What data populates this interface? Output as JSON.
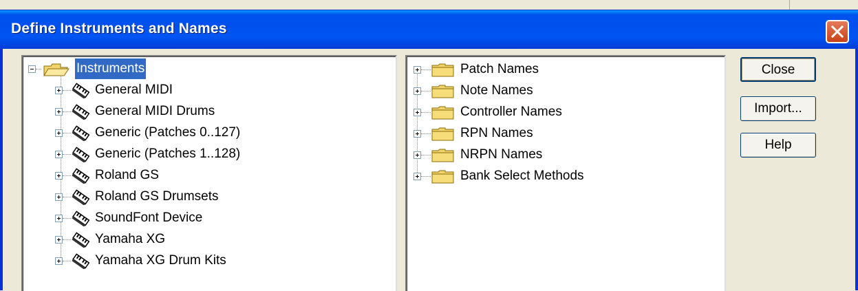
{
  "dialog": {
    "title": "Define Instruments and Names",
    "close_icon": "close-x-icon"
  },
  "left_tree": {
    "root": {
      "label": "Instruments",
      "expanded": true,
      "selected": true
    },
    "items": [
      "General MIDI",
      "General MIDI Drums",
      "Generic (Patches 0..127)",
      "Generic (Patches 1..128)",
      "Roland GS",
      "Roland GS Drumsets",
      "SoundFont Device",
      "Yamaha XG",
      "Yamaha XG Drum Kits"
    ]
  },
  "right_tree": {
    "items": [
      "Patch Names",
      "Note Names",
      "Controller Names",
      "RPN Names",
      "NRPN Names",
      "Bank Select Methods"
    ]
  },
  "buttons": {
    "close": "Close",
    "import": "Import...",
    "help": "Help"
  },
  "colors": {
    "titlebar": "#0055ea",
    "selection": "#316ac5",
    "folder": "#f3d36b"
  }
}
